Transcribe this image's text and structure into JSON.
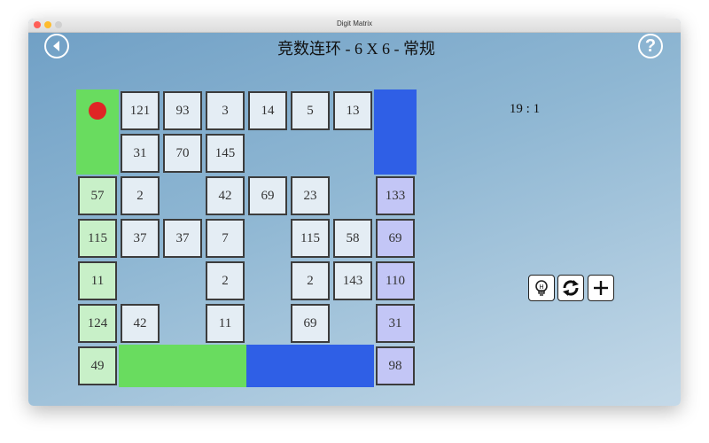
{
  "window": {
    "title": "Digit Matrix"
  },
  "header": {
    "title": "竞数连环 - 6 X 6 - 常规"
  },
  "score": "19 : 1",
  "icons": {
    "back": "back-arrow-icon",
    "help": "question-mark-icon",
    "hint": "lightbulb-icon",
    "restart": "refresh-icon",
    "new": "plus-icon"
  },
  "colors": {
    "green_player": "#69dc5f",
    "blue_player": "#2f5fe6",
    "green_light": "#c8f0c8",
    "blue_light": "#c3c6f6",
    "marker": "#e02525"
  },
  "board": {
    "numbers": [
      [
        "121",
        "93",
        "3",
        "14",
        "5",
        "13"
      ],
      [
        "31",
        "70",
        "145",
        "",
        "",
        ""
      ],
      [
        "2",
        "",
        "42",
        "69",
        "23",
        ""
      ],
      [
        "37",
        "37",
        "7",
        "",
        "115",
        "58"
      ],
      [
        "",
        "",
        "2",
        "",
        "2",
        "143"
      ],
      [
        "42",
        "",
        "11",
        "",
        "69",
        ""
      ]
    ],
    "green_column": [
      "57",
      "115",
      "11",
      "124",
      "49"
    ],
    "blue_column": [
      "133",
      "69",
      "110",
      "31",
      "98"
    ]
  }
}
